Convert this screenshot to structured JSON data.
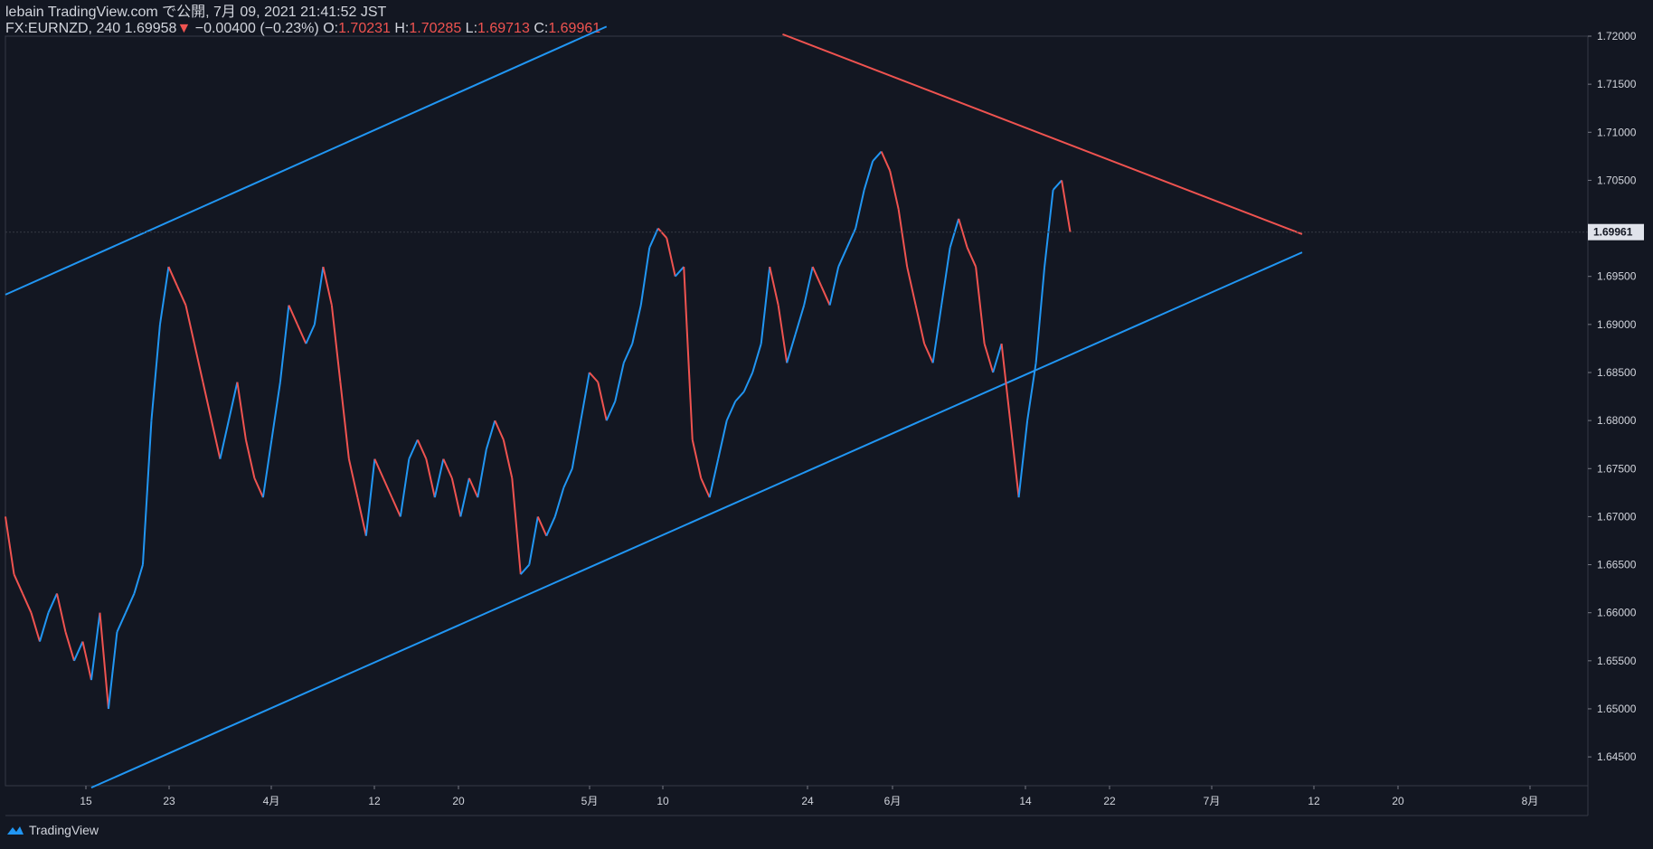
{
  "header": {
    "line1": "lebain TradingView.com で公開, 7月 09, 2021 21:41:52 JST",
    "symbol": "FX:EURNZD, 240",
    "last": "1.69958",
    "change": "−0.00400 (−0.23%)",
    "o_label": "O:",
    "o_value": "1.70231",
    "h_label": "H:",
    "h_value": "1.70285",
    "l_label": "L:",
    "l_value": "1.69713",
    "c_label": "C:",
    "c_value": "1.69961"
  },
  "footer": {
    "brand": "TradingView"
  },
  "colors": {
    "bg": "#131722",
    "up": "#2196f3",
    "down": "#ef5350",
    "text": "#d1d4dc"
  },
  "chart_data": {
    "type": "line",
    "symbol": "FX:EURNZD",
    "interval": "240",
    "ylim": [
      1.642,
      1.72
    ],
    "y_ticks": [
      "1.72000",
      "1.71500",
      "1.71000",
      "1.70500",
      "1.70000",
      "1.69500",
      "1.69000",
      "1.68500",
      "1.68000",
      "1.67500",
      "1.67000",
      "1.66500",
      "1.66000",
      "1.65500",
      "1.65000",
      "1.64500"
    ],
    "x_ticks": [
      "15",
      "23",
      "4月",
      "12",
      "20",
      "5月",
      "10",
      "24",
      "6月",
      "14",
      "22",
      "7月",
      "12",
      "20",
      "8月"
    ],
    "last_price": "1.69961",
    "series": [
      {
        "x": [
          0,
          10,
          20,
          30,
          40,
          50,
          60,
          70,
          80,
          90,
          100,
          110,
          120,
          130,
          140,
          150,
          160,
          170,
          180,
          190,
          200,
          210,
          220,
          230,
          240,
          250,
          260,
          270,
          280,
          290,
          300,
          310,
          320,
          330,
          340,
          350,
          360,
          370,
          380,
          390,
          400,
          410,
          420,
          430,
          440,
          450,
          460,
          470,
          480,
          490,
          500,
          510,
          520,
          530,
          540,
          550,
          560,
          570,
          580,
          590,
          600,
          610,
          620,
          630,
          640,
          650,
          660,
          670,
          680,
          690,
          700,
          710,
          720,
          730,
          740,
          750,
          760,
          770,
          780,
          790,
          800,
          810,
          820,
          830,
          840,
          850,
          860,
          870,
          880,
          890,
          900,
          910,
          920,
          930,
          940,
          950,
          960,
          970,
          980,
          990,
          1000,
          1010,
          1020,
          1030,
          1040,
          1050,
          1060,
          1070,
          1080,
          1090,
          1100,
          1110,
          1120,
          1130,
          1140,
          1150,
          1160,
          1170,
          1180,
          1190,
          1200,
          1210,
          1220,
          1230,
          1240
        ],
        "y": [
          1.67,
          1.664,
          1.662,
          1.66,
          1.657,
          1.66,
          1.662,
          1.658,
          1.655,
          1.657,
          1.653,
          1.66,
          1.65,
          1.658,
          1.66,
          1.662,
          1.665,
          1.68,
          1.69,
          1.696,
          1.694,
          1.692,
          1.688,
          1.684,
          1.68,
          1.676,
          1.68,
          1.684,
          1.678,
          1.674,
          1.672,
          1.678,
          1.684,
          1.692,
          1.69,
          1.688,
          1.69,
          1.696,
          1.692,
          1.684,
          1.676,
          1.672,
          1.668,
          1.676,
          1.674,
          1.672,
          1.67,
          1.676,
          1.678,
          1.676,
          1.672,
          1.676,
          1.674,
          1.67,
          1.674,
          1.672,
          1.677,
          1.68,
          1.678,
          1.674,
          1.664,
          1.665,
          1.67,
          1.668,
          1.67,
          1.673,
          1.675,
          1.68,
          1.685,
          1.684,
          1.68,
          1.682,
          1.686,
          1.688,
          1.692,
          1.698,
          1.7,
          1.699,
          1.695,
          1.696,
          1.678,
          1.674,
          1.672,
          1.676,
          1.68,
          1.682,
          1.683,
          1.685,
          1.688,
          1.696,
          1.692,
          1.686,
          1.689,
          1.692,
          1.696,
          1.694,
          1.692,
          1.696,
          1.698,
          1.7,
          1.704,
          1.707,
          1.708,
          1.706,
          1.702,
          1.696,
          1.692,
          1.688,
          1.686,
          1.692,
          1.698,
          1.701,
          1.698,
          1.696,
          1.688,
          1.685,
          1.688,
          1.68,
          1.672,
          1.68,
          1.686,
          1.696,
          1.704,
          1.705,
          1.6996
        ]
      }
    ],
    "trend_lines": [
      {
        "color": "#2196f3",
        "x1": 0,
        "y1": 1.6931,
        "x2": 700,
        "y2": 1.721
      },
      {
        "color": "#2196f3",
        "x1": 100,
        "y1": 1.6418,
        "x2": 1510,
        "y2": 1.6975
      },
      {
        "color": "#ef5350",
        "x1": 905,
        "y1": 1.7202,
        "x2": 1510,
        "y2": 1.6994
      }
    ],
    "grid": false,
    "legend": "none"
  }
}
